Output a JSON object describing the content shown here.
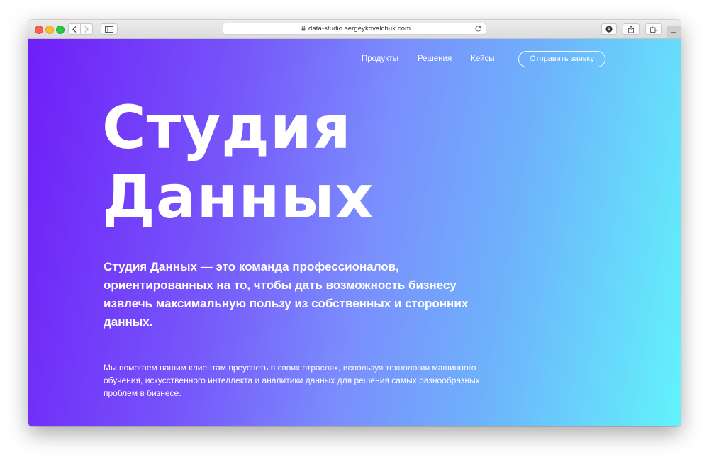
{
  "browser": {
    "url": "data-studio.sergeykovalchuk.com"
  },
  "nav": {
    "items": [
      {
        "label": "Продукты"
      },
      {
        "label": "Решения"
      },
      {
        "label": "Кейсы"
      }
    ],
    "cta_label": "Отправить заявку"
  },
  "hero": {
    "title_line1": "Студия",
    "title_line2": "Данных",
    "lead": "Студия Данных — это команда профессионалов, ориентированных на то, чтобы дать возможность бизнесу извлечь максимальную пользу из собственных и сторонних данных.",
    "description": "Мы помогаем нашим клиентам преуспеть в своих отраслях, используя технологии машинного обучения, искусственного интеллекта и аналитики данных для решения самых разнообразных проблем в бизнесе."
  },
  "icons": {
    "lock": "lock-icon",
    "reload": "reload-icon",
    "download": "download-icon",
    "share": "share-icon",
    "tabs": "tabs-icon",
    "sidebar": "sidebar-icon"
  },
  "colors": {
    "gradient_start": "#6f1ef8",
    "gradient_mid": "#7a8efd",
    "gradient_end": "#62f3fb"
  }
}
